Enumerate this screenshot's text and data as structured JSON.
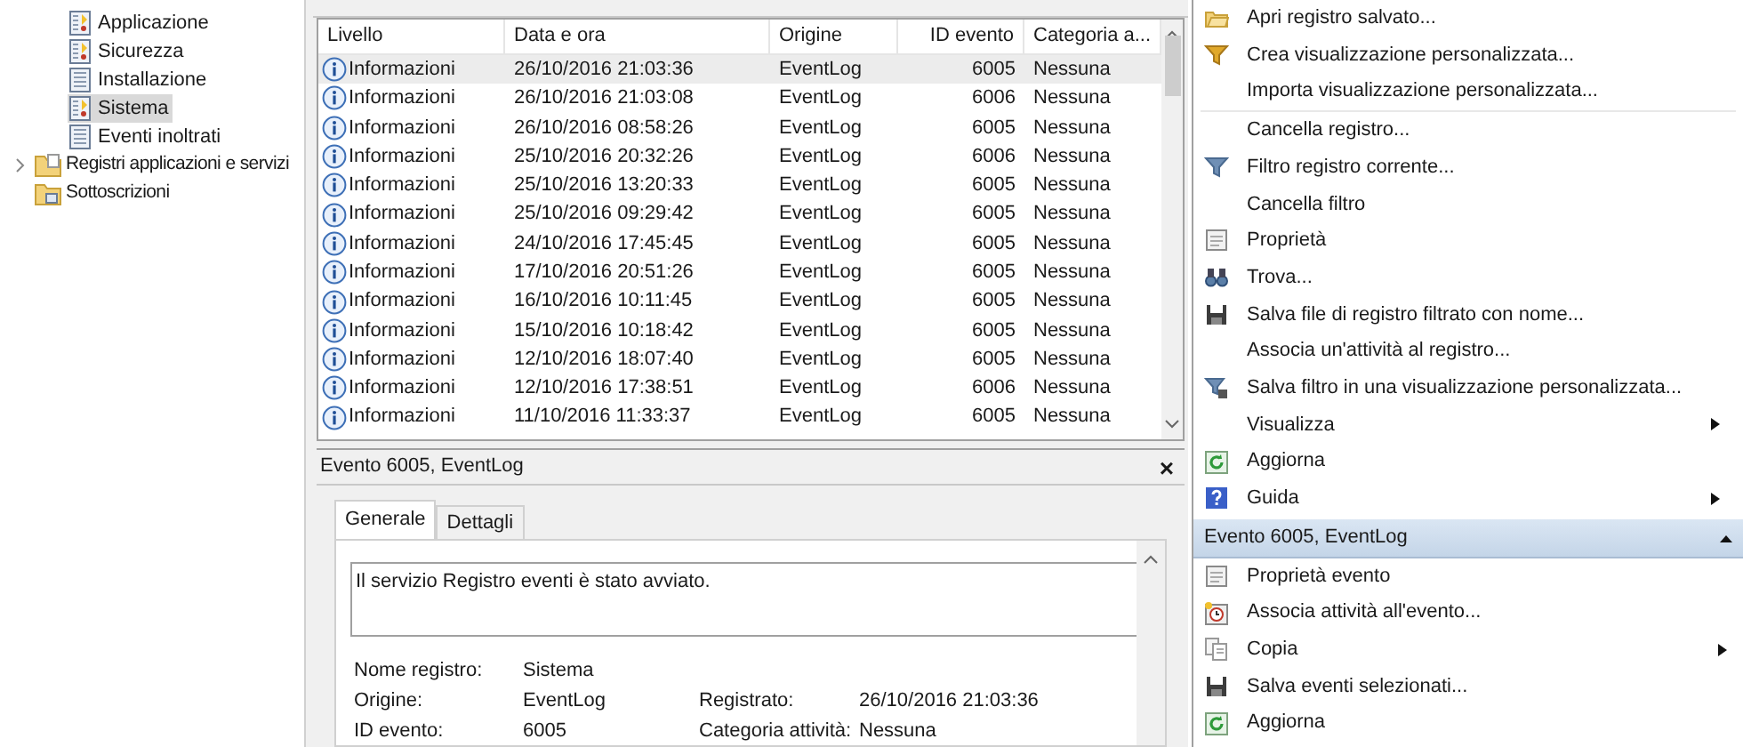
{
  "tree": {
    "items": [
      {
        "label": "Applicazione",
        "kind": "colored",
        "selected": false
      },
      {
        "label": "Sicurezza",
        "kind": "colored",
        "selected": false
      },
      {
        "label": "Installazione",
        "kind": "plain",
        "selected": false
      },
      {
        "label": "Sistema",
        "kind": "colored",
        "selected": true
      },
      {
        "label": "Eventi inoltrati",
        "kind": "plain",
        "selected": false
      }
    ],
    "roots": [
      {
        "label": "Registri applicazioni e servizi",
        "kind": "folder",
        "expandable": true
      },
      {
        "label": "Sottoscrizioni",
        "kind": "subscriptions",
        "expandable": false
      }
    ]
  },
  "table": {
    "columns": [
      {
        "label": "Livello",
        "kind": "text"
      },
      {
        "label": "Data e ora",
        "kind": "text"
      },
      {
        "label": "Origine",
        "kind": "text"
      },
      {
        "label": "ID evento",
        "kind": "number"
      },
      {
        "label": "Categoria a...",
        "kind": "text"
      }
    ],
    "rows": [
      {
        "selected": true,
        "cells": [
          "Informazioni",
          "26/10/2016 21:03:36",
          "EventLog",
          "6005",
          "Nessuna"
        ]
      },
      {
        "selected": false,
        "cells": [
          "Informazioni",
          "26/10/2016 21:03:08",
          "EventLog",
          "6006",
          "Nessuna"
        ]
      },
      {
        "selected": false,
        "cells": [
          "Informazioni",
          "26/10/2016 08:58:26",
          "EventLog",
          "6005",
          "Nessuna"
        ]
      },
      {
        "selected": false,
        "cells": [
          "Informazioni",
          "25/10/2016 20:32:26",
          "EventLog",
          "6006",
          "Nessuna"
        ]
      },
      {
        "selected": false,
        "cells": [
          "Informazioni",
          "25/10/2016 13:20:33",
          "EventLog",
          "6005",
          "Nessuna"
        ]
      },
      {
        "selected": false,
        "cells": [
          "Informazioni",
          "25/10/2016 09:29:42",
          "EventLog",
          "6005",
          "Nessuna"
        ]
      },
      {
        "selected": false,
        "cells": [
          "Informazioni",
          "24/10/2016 17:45:45",
          "EventLog",
          "6005",
          "Nessuna"
        ]
      },
      {
        "selected": false,
        "cells": [
          "Informazioni",
          "17/10/2016 20:51:26",
          "EventLog",
          "6005",
          "Nessuna"
        ]
      },
      {
        "selected": false,
        "cells": [
          "Informazioni",
          "16/10/2016 10:11:45",
          "EventLog",
          "6005",
          "Nessuna"
        ]
      },
      {
        "selected": false,
        "cells": [
          "Informazioni",
          "15/10/2016 10:18:42",
          "EventLog",
          "6005",
          "Nessuna"
        ]
      },
      {
        "selected": false,
        "cells": [
          "Informazioni",
          "12/10/2016 18:07:40",
          "EventLog",
          "6005",
          "Nessuna"
        ]
      },
      {
        "selected": false,
        "cells": [
          "Informazioni",
          "12/10/2016 17:38:51",
          "EventLog",
          "6006",
          "Nessuna"
        ]
      },
      {
        "selected": false,
        "cells": [
          "Informazioni",
          "11/10/2016 11:33:37",
          "EventLog",
          "6005",
          "Nessuna"
        ]
      }
    ]
  },
  "details": {
    "title": "Evento 6005, EventLog",
    "close": "×",
    "tabs": [
      {
        "label": "Generale",
        "selected": true
      },
      {
        "label": "Dettagli",
        "selected": false
      }
    ],
    "message": "Il servizio Registro eventi è stato avviato.",
    "fields": [
      [
        {
          "label": "Nome registro:",
          "value": "Sistema"
        }
      ],
      [
        {
          "label": "Origine:",
          "value": "EventLog"
        },
        {
          "label": "Registrato:",
          "value": "26/10/2016 21:03:36"
        }
      ],
      [
        {
          "label": "ID evento:",
          "value": "6005"
        },
        {
          "label": "Categoria attività:",
          "value": "Nessuna"
        }
      ]
    ]
  },
  "actions": {
    "sections": [
      {
        "groups": [
          [
            {
              "label": "Apri registro salvato...",
              "kind": "folder",
              "submenu": false
            },
            {
              "label": "Crea visualizzazione personalizzata...",
              "kind": "funnel-gold",
              "submenu": false
            },
            {
              "label": "Importa visualizzazione personalizzata...",
              "kind": "none",
              "submenu": false
            }
          ],
          [
            {
              "label": "Cancella registro...",
              "kind": "none",
              "submenu": false
            },
            {
              "label": "Filtro registro corrente...",
              "kind": "funnel",
              "submenu": false
            },
            {
              "label": "Cancella filtro",
              "kind": "none",
              "submenu": false
            },
            {
              "label": "Proprietà",
              "kind": "sheet",
              "submenu": false
            },
            {
              "label": "Trova...",
              "kind": "binoculars",
              "submenu": false
            },
            {
              "label": "Salva file di registro filtrato con nome...",
              "kind": "disk",
              "submenu": false
            },
            {
              "label": "Associa un'attività al registro...",
              "kind": "none",
              "submenu": false
            },
            {
              "label": "Salva filtro in una visualizzazione personalizzata...",
              "kind": "funnel-save",
              "submenu": false
            },
            {
              "label": "Visualizza",
              "kind": "none",
              "submenu": true
            },
            {
              "label": "Aggiorna",
              "kind": "refresh",
              "submenu": false
            },
            {
              "label": "Guida",
              "kind": "help",
              "submenu": true
            }
          ]
        ]
      },
      {
        "header": "Evento 6005, EventLog",
        "expanded": true,
        "groups": [
          [
            {
              "label": "Proprietà evento",
              "kind": "sheet",
              "submenu": false
            },
            {
              "label": "Associa attività all'evento...",
              "kind": "clock",
              "submenu": false
            },
            {
              "label": "Copia",
              "kind": "copy",
              "submenu": true
            },
            {
              "label": "Salva eventi selezionati...",
              "kind": "disk",
              "submenu": false
            },
            {
              "label": "Aggiorna",
              "kind": "refresh",
              "submenu": false
            }
          ]
        ]
      }
    ]
  }
}
